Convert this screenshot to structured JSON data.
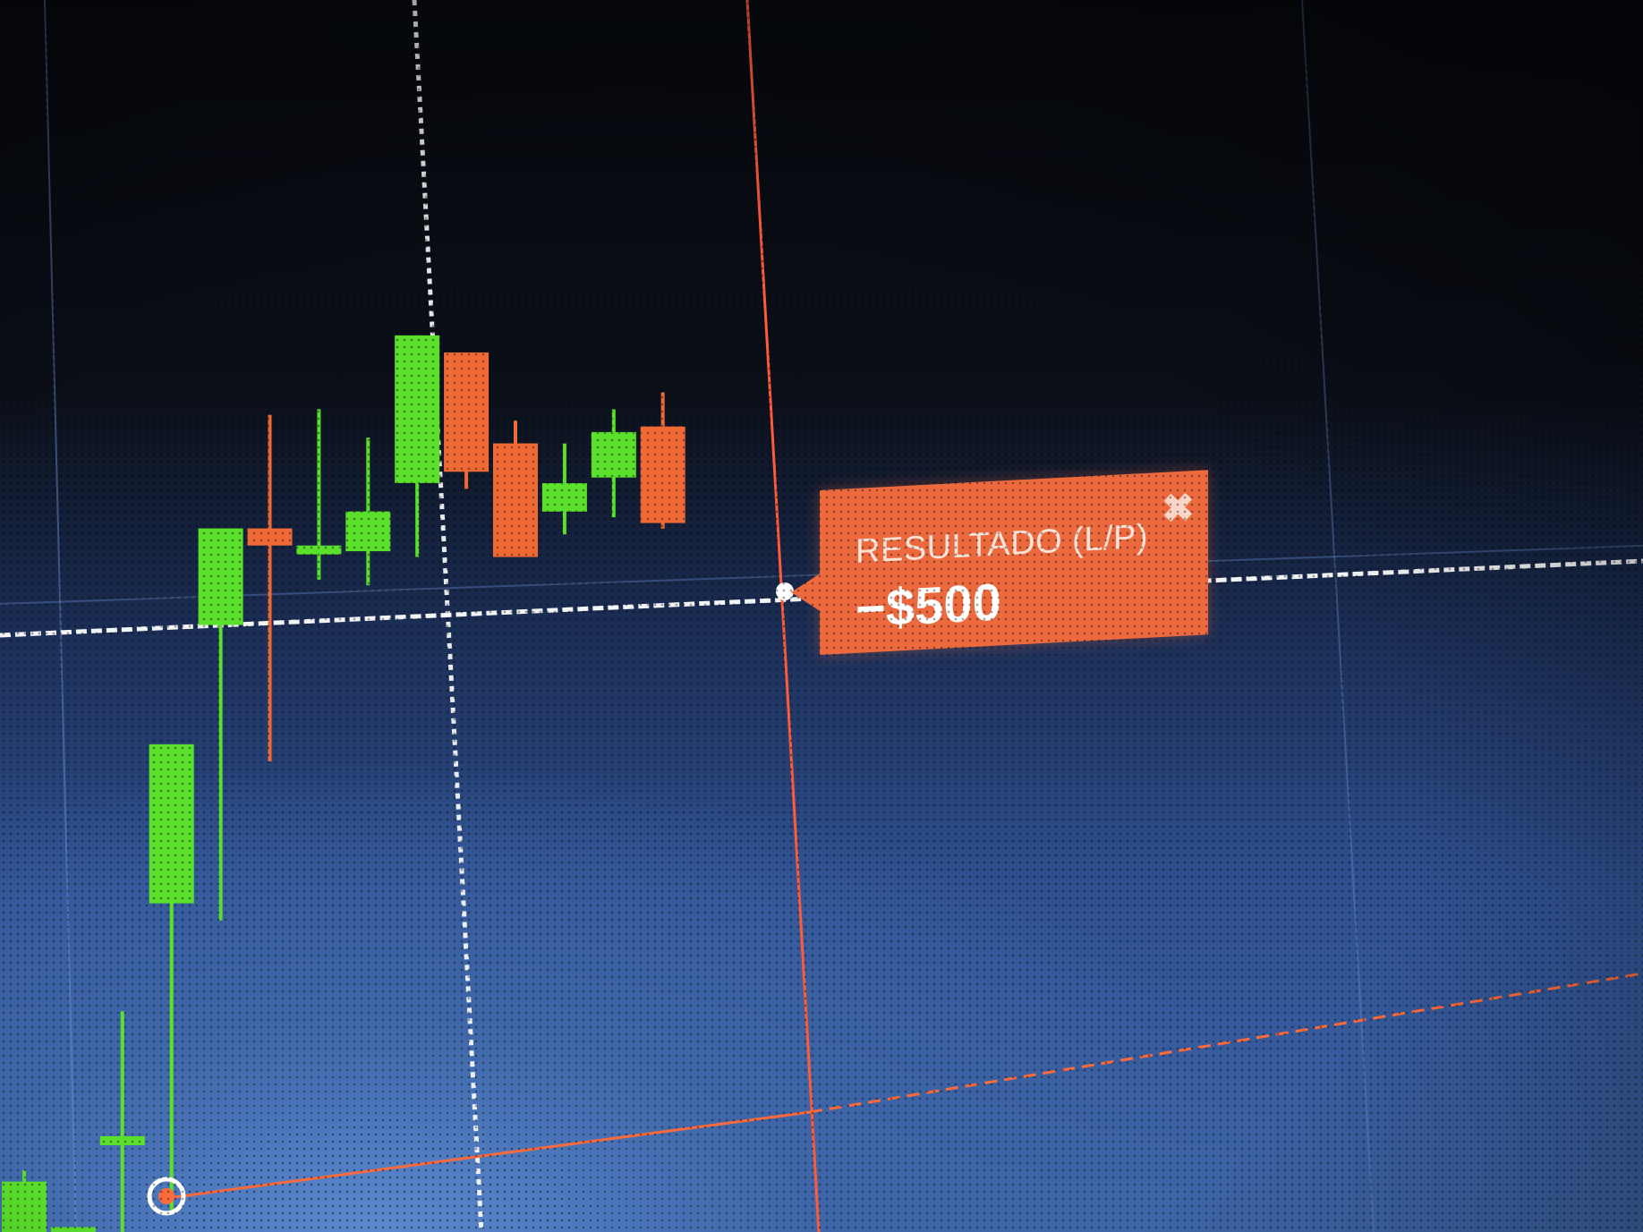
{
  "colors": {
    "bullish": "#5be02c",
    "bearish": "#f06a35",
    "price_line": "#ffffff",
    "time_line": "#ff5a3a",
    "target_line": "#ff6a3a",
    "grid": "#7aa0e0",
    "result_panel": "#ed6a3f"
  },
  "result_panel": {
    "label": "RESULTADO (L/P)",
    "value": "−$500"
  },
  "icons": {
    "close": "close-icon",
    "entry_marker": "entry-marker-icon"
  },
  "candles": [
    {
      "open": 2,
      "high": 14,
      "low": 0,
      "close": 12
    },
    {
      "open": 0,
      "high": 0.5,
      "low": 0,
      "close": 3
    },
    {
      "open": 18,
      "high": 40,
      "low": 0,
      "close": 18
    },
    {
      "open": 58,
      "high": 85,
      "low": 4,
      "close": 86
    },
    {
      "open": 106,
      "high": 109,
      "low": 54,
      "close": 123
    },
    {
      "open": 122,
      "high": 142,
      "low": 81,
      "close": 119
    },
    {
      "open": 118,
      "high": 142,
      "low": 112,
      "close": 118
    },
    {
      "open": 116,
      "high": 136,
      "low": 110,
      "close": 123
    },
    {
      "open": 127,
      "high": 140,
      "low": 114,
      "close": 153
    },
    {
      "open": 149,
      "high": 149,
      "low": 125,
      "close": 128
    },
    {
      "open": 132,
      "high": 136,
      "low": 121,
      "close": 112
    },
    {
      "open": 119,
      "high": 131,
      "low": 115,
      "close": 124
    },
    {
      "open": 124,
      "high": 136,
      "low": 117,
      "close": 132
    },
    {
      "open": 132,
      "high": 138,
      "low": 114,
      "close": 115
    }
  ]
}
